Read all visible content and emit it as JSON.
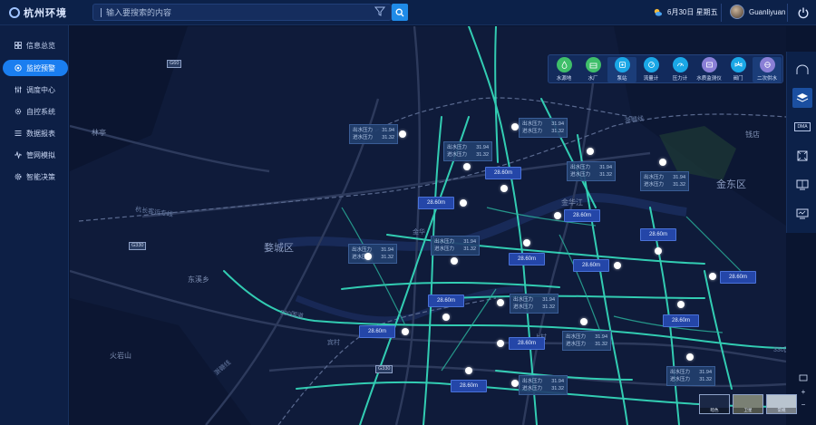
{
  "app": {
    "logo_text": "杭州环境"
  },
  "search": {
    "placeholder": "输入要搜索的内容"
  },
  "header": {
    "date": "6月30日 星期五",
    "username": "Guanliyuan"
  },
  "sidebar": {
    "items": [
      {
        "label": "信息总览",
        "icon": "grid-icon",
        "active": false
      },
      {
        "label": "监控预警",
        "icon": "monitor-icon",
        "active": true
      },
      {
        "label": "调度中心",
        "icon": "sliders-icon",
        "active": false
      },
      {
        "label": "自控系统",
        "icon": "gear-icon",
        "active": false
      },
      {
        "label": "数据报表",
        "icon": "list-icon",
        "active": false
      },
      {
        "label": "管网模拟",
        "icon": "pulse-icon",
        "active": false
      },
      {
        "label": "智能决策",
        "icon": "cog-icon",
        "active": false
      }
    ]
  },
  "layers": {
    "items": [
      {
        "label": "水源地",
        "color": "#3fbf6a"
      },
      {
        "label": "水厂",
        "color": "#3fbf6a"
      },
      {
        "label": "泵站",
        "color": "#1aa7e6"
      },
      {
        "label": "流量计",
        "color": "#1aa7e6"
      },
      {
        "label": "压力计",
        "color": "#1aa7e6"
      },
      {
        "label": "水质监测仪",
        "color": "#8a7fd6"
      },
      {
        "label": "阀门",
        "color": "#1aa7e6"
      },
      {
        "label": "二次供水",
        "color": "#8a7fd6"
      }
    ]
  },
  "right_tools": {
    "dma_label": "DMA"
  },
  "map": {
    "places": [
      {
        "name": "林亭"
      },
      {
        "name": "杭长客运专线"
      },
      {
        "name": "婺城区"
      },
      {
        "name": "东溪乡"
      },
      {
        "name": "火岩山"
      },
      {
        "name": "钱店"
      },
      {
        "name": "金东区"
      },
      {
        "name": "金华江"
      },
      {
        "name": "浙赣线"
      },
      {
        "name": "浙赣线"
      },
      {
        "name": "金华"
      },
      {
        "name": "宾村"
      },
      {
        "name": "上村"
      }
    ],
    "shields": [
      {
        "text": "G60"
      },
      {
        "text": "G330"
      },
      {
        "text": "G330"
      },
      {
        "text": "330国道"
      },
      {
        "text": "330国道"
      }
    ],
    "pressure_label_out": "出水压力",
    "pressure_label_in": "进水压力",
    "pressure_boxes": [
      {
        "out": "31.94",
        "in": "31.32"
      },
      {
        "out": "31.94",
        "in": "31.32"
      },
      {
        "out": "31.94",
        "in": "31.32"
      },
      {
        "out": "31.94",
        "in": "31.32"
      },
      {
        "out": "31.94",
        "in": "31.32"
      },
      {
        "out": "31.94",
        "in": "31.32"
      },
      {
        "out": "31.94",
        "in": "31.32"
      },
      {
        "out": "31.94",
        "in": "31.32"
      },
      {
        "out": "31.94",
        "in": "31.32"
      },
      {
        "out": "31.94",
        "in": "31.32"
      },
      {
        "out": "31.94",
        "in": "31.32"
      },
      {
        "out": "31.94",
        "in": "31.32"
      }
    ],
    "depth_tags": [
      "28.60m",
      "28.60m",
      "28.60m",
      "28.60m",
      "28.60m",
      "28.60m",
      "28.60m",
      "28.60m",
      "28.60m",
      "28.60m",
      "28.60m",
      "28.60m"
    ]
  },
  "basemaps": {
    "items": [
      "暗色",
      "卫星",
      "常规"
    ]
  }
}
